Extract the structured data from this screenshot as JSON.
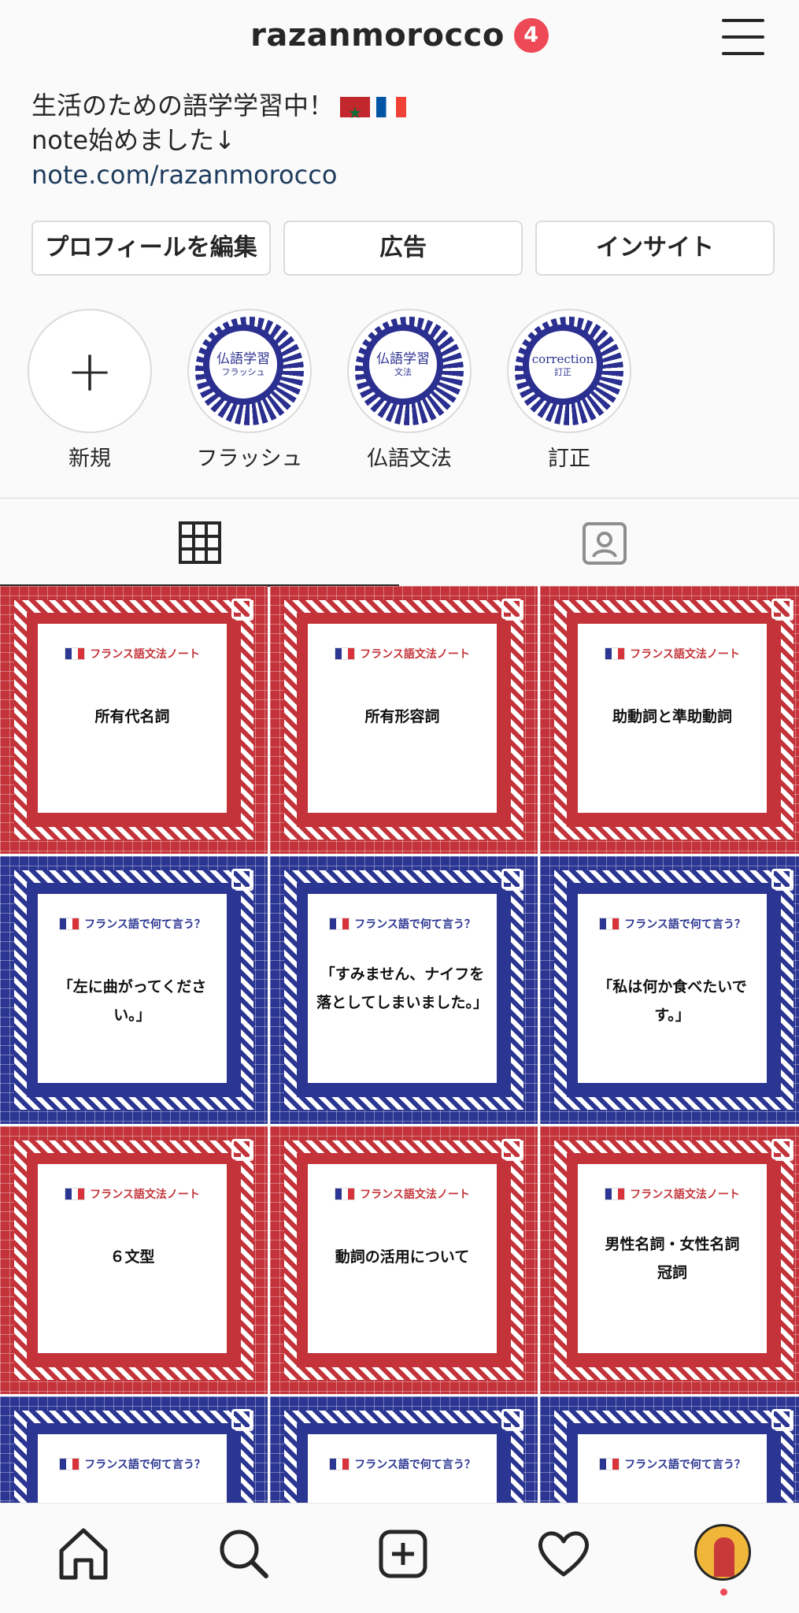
{
  "header": {
    "username": "razanmorocco",
    "notification_count": "4"
  },
  "bio": {
    "line1": "生活のための語学学習中！",
    "line2": "note始めました↓",
    "link": "note.com/razanmorocco"
  },
  "actions": {
    "edit_profile": "プロフィールを編集",
    "ads": "広告",
    "insights": "インサイト"
  },
  "highlights": [
    {
      "label": "新規",
      "inner1": "",
      "inner2": ""
    },
    {
      "label": "フラッシュ",
      "inner1": "仏語学習",
      "inner2": "フラッシュ"
    },
    {
      "label": "仏語文法",
      "inner1": "仏語学習",
      "inner2": "文法"
    },
    {
      "label": "訂正",
      "inner1": "correction",
      "inner2": "訂正"
    }
  ],
  "posts": [
    {
      "theme": "red",
      "header": "フランス語文法ノート",
      "title": "所有代名詞"
    },
    {
      "theme": "red",
      "header": "フランス語文法ノート",
      "title": "所有形容詞"
    },
    {
      "theme": "red",
      "header": "フランス語文法ノート",
      "title": "助動詞と準助動詞"
    },
    {
      "theme": "blue",
      "header": "フランス語で何て言う？",
      "title": "「左に曲がってください。」"
    },
    {
      "theme": "blue",
      "header": "フランス語で何て言う？",
      "title": "「すみません、ナイフを\n落としてしまいました。」"
    },
    {
      "theme": "blue",
      "header": "フランス語で何て言う？",
      "title": "「私は何か食べたいです。」"
    },
    {
      "theme": "red",
      "header": "フランス語文法ノート",
      "title": "６文型"
    },
    {
      "theme": "red",
      "header": "フランス語文法ノート",
      "title": "動詞の活用について"
    },
    {
      "theme": "red",
      "header": "フランス語文法ノート",
      "title": "男性名詞・女性名詞\n冠詞"
    },
    {
      "theme": "blue",
      "header": "フランス語で何て言う？",
      "title": ""
    },
    {
      "theme": "blue",
      "header": "フランス語で何て言う？",
      "title": ""
    },
    {
      "theme": "blue",
      "header": "フランス語で何て言う？",
      "title": ""
    }
  ],
  "colors": {
    "accent_red": "#c33339",
    "accent_blue": "#2b3592",
    "badge": "#ed4956"
  }
}
